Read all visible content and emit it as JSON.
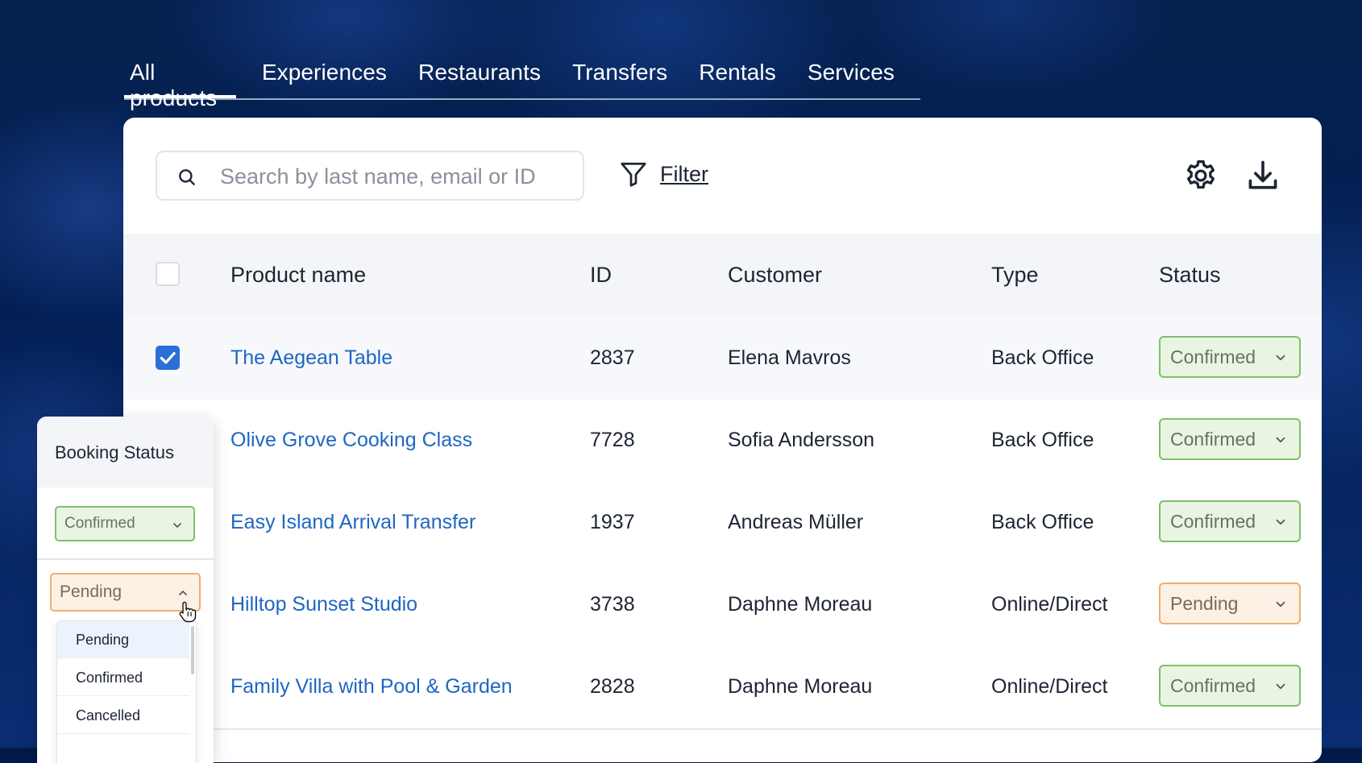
{
  "tabs": [
    {
      "label": "All products",
      "active": true
    },
    {
      "label": "Experiences"
    },
    {
      "label": "Restaurants"
    },
    {
      "label": "Transfers"
    },
    {
      "label": "Rentals"
    },
    {
      "label": "Services"
    }
  ],
  "toolbar": {
    "search_placeholder": "Search by last name, email or ID",
    "filter_label": "Filter"
  },
  "table": {
    "columns": [
      "Product name",
      "ID",
      "Customer",
      "Type",
      "Status"
    ],
    "rows": [
      {
        "name": "The Aegean Table",
        "id": "2837",
        "customer": "Elena Mavros",
        "type": "Back Office",
        "status": "Confirmed",
        "checked": true
      },
      {
        "name": "Olive Grove Cooking Class",
        "id": "7728",
        "customer": "Sofia Andersson",
        "type": "Back Office",
        "status": "Confirmed"
      },
      {
        "name": "Easy Island Arrival Transfer",
        "id": "1937",
        "customer": "Andreas Müller",
        "type": "Back Office",
        "status": "Confirmed"
      },
      {
        "name": "Hilltop Sunset Studio",
        "id": "3738",
        "customer": "Daphne Moreau",
        "type": "Online/Direct",
        "status": "Pending"
      },
      {
        "name": "Family Villa with Pool & Garden",
        "id": "2828",
        "customer": "Daphne Moreau",
        "type": "Online/Direct",
        "status": "Confirmed"
      }
    ]
  },
  "panel": {
    "title": "Booking Status",
    "confirmed_value": "Confirmed",
    "pending_value": "Pending",
    "options": [
      "Pending",
      "Confirmed",
      "Cancelled"
    ]
  },
  "colors": {
    "link": "#1f66c1",
    "confirmed_border": "#7cc16a",
    "pending_border": "#f0ad73",
    "checkbox": "#2c6fd6"
  }
}
